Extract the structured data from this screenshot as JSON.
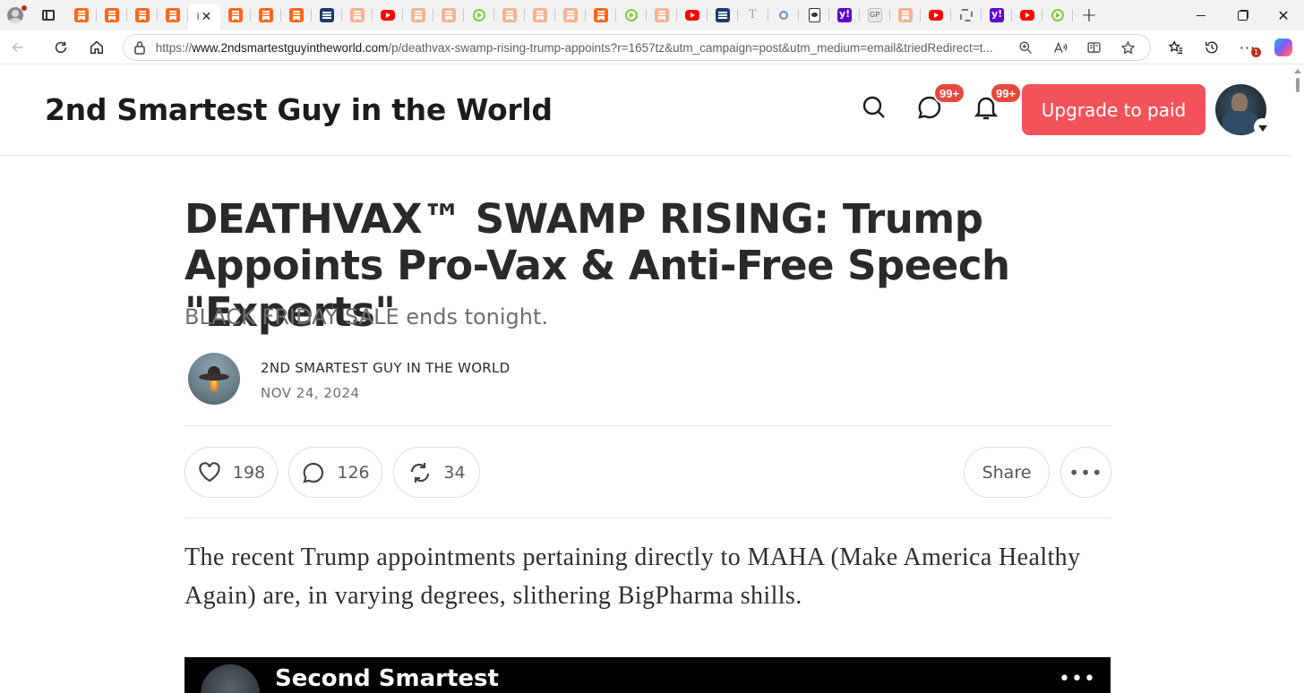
{
  "browser": {
    "active_tab_text": "I",
    "active_tab_close": "✕",
    "new_tab": "+",
    "window_close": "✕",
    "favicons": [
      "substack",
      "substack",
      "substack",
      "substack",
      "active",
      "substack",
      "substack",
      "substack",
      "news",
      "substack-faded",
      "youtube",
      "substack-faded",
      "substack-faded",
      "rumble",
      "substack-faded",
      "substack-faded",
      "substack-faded",
      "substack",
      "rumble",
      "substack-faded",
      "youtube",
      "news",
      "twitter",
      "search",
      "doc",
      "yahoo",
      "gp",
      "substack-faded",
      "youtube",
      "gear",
      "yahoo",
      "youtube",
      "rumble"
    ],
    "url_prefix": "https://",
    "url_host": "www.2ndsmartestguyintheworld.com",
    "url_path": "/p/deathvax-swamp-rising-trump-appoints?r=1657tz&utm_campaign=post&utm_medium=email&triedRedirect=t...",
    "tools_badge": "1",
    "colors": {
      "accent": "#f4525a",
      "badge": "#e8473d"
    }
  },
  "header": {
    "site_title": "2nd Smartest Guy in the World",
    "chat_badge": "99+",
    "notifications_badge": "99+",
    "upgrade_label": "Upgrade to paid"
  },
  "post": {
    "title": "DEATHVAX™ SWAMP RISING: Trump Appoints Pro-Vax & Anti-Free Speech \"Experts\"",
    "subtitle": "BLACK FRIDAY SALE ends tonight.",
    "author": "2ND SMARTEST GUY IN THE WORLD",
    "date": "NOV 24, 2024",
    "likes": "198",
    "comments": "126",
    "restacks": "34",
    "share_label": "Share",
    "more_label": "•••",
    "body": "The recent Trump appointments pertaining directly to MAHA (Make America Healthy Again) are, in varying degrees, slithering BigPharma shills."
  },
  "embed": {
    "channel_title": "Second Smartest",
    "more_label": "•••"
  }
}
